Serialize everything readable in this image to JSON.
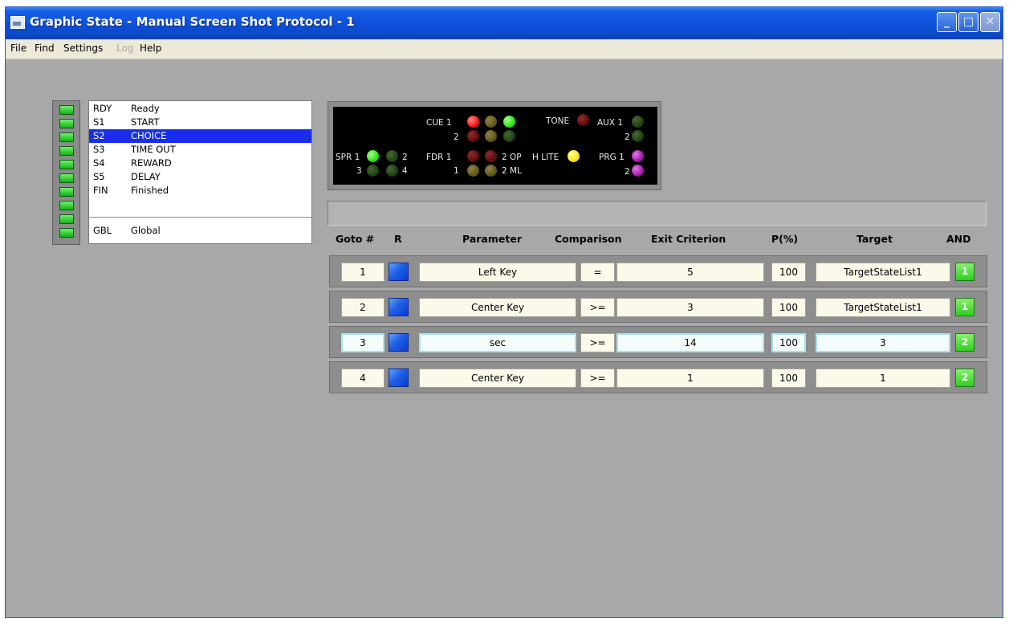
{
  "window": {
    "title": "Graphic State - Manual Screen Shot Protocol - 1",
    "minimize_glyph": "_",
    "maximize_glyph": "□",
    "close_glyph": "✕"
  },
  "menu": {
    "file": "File",
    "find": "Find",
    "settings": "Settings",
    "log": "Log",
    "help": "Help"
  },
  "states": [
    {
      "code": "RDY",
      "name": "Ready",
      "selected": false
    },
    {
      "code": "S1",
      "name": "START",
      "selected": false
    },
    {
      "code": "S2",
      "name": "CHOICE",
      "selected": true
    },
    {
      "code": "S3",
      "name": "TIME OUT",
      "selected": false
    },
    {
      "code": "S4",
      "name": "REWARD",
      "selected": false
    },
    {
      "code": "S5",
      "name": "DELAY",
      "selected": false
    },
    {
      "code": "FIN",
      "name": "Finished",
      "selected": false
    },
    {
      "code": "GBL",
      "name": "Global",
      "selected": false
    }
  ],
  "io": {
    "cue1": "CUE 1",
    "cue2": "2",
    "tone": "TONE",
    "aux1": "AUX 1",
    "aux2": "2",
    "spr1": "SPR 1",
    "spr2": "2",
    "spr3": "3",
    "spr4": "4",
    "fdr1": "FDR 1",
    "fdr2op": "2 OP",
    "fdr1b": "1",
    "fdr2ml": "2 ML",
    "hlite": "H LITE",
    "prg1": "PRG 1",
    "prg2": "2"
  },
  "table": {
    "headers": {
      "goto": "Goto #",
      "r": "R",
      "parameter": "Parameter",
      "comparison": "Comparison",
      "exit": "Exit Criterion",
      "p": "P(%)",
      "target": "Target",
      "and": "AND"
    },
    "rows": [
      {
        "goto": "1",
        "parameter": "Left Key",
        "comparison": "=",
        "exit": "5",
        "p": "100",
        "target": "TargetStateList1",
        "and": "1"
      },
      {
        "goto": "2",
        "parameter": "Center Key",
        "comparison": ">=",
        "exit": "3",
        "p": "100",
        "target": "TargetStateList1",
        "and": "1"
      },
      {
        "goto": "3",
        "parameter": "sec",
        "comparison": ">=",
        "exit": "14",
        "p": "100",
        "target": "3",
        "and": "2"
      },
      {
        "goto": "4",
        "parameter": "Center Key",
        "comparison": ">=",
        "exit": "1",
        "p": "100",
        "target": "1",
        "and": "2"
      }
    ]
  },
  "colors": {
    "titlebar": "#0d4fd9",
    "selection": "#1a2ee8",
    "led_green": "#2be31a",
    "r_button": "#1f5fe6"
  }
}
